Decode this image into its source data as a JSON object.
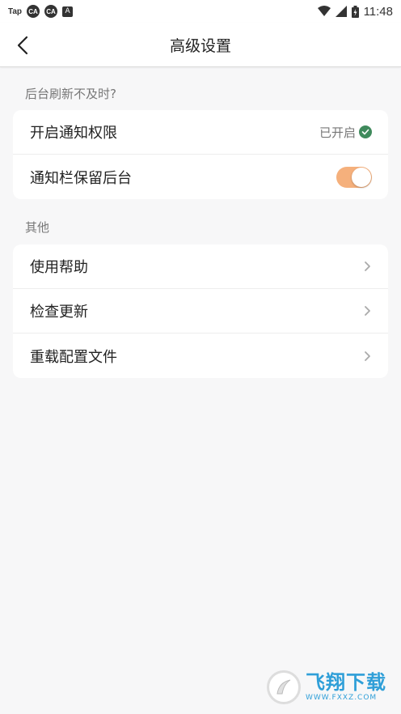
{
  "statusbar": {
    "app_label": "Tap",
    "icon1": "CA",
    "icon2": "CA",
    "icon3": "A",
    "time": "11:48"
  },
  "header": {
    "title": "高级设置"
  },
  "sections": [
    {
      "label": "后台刷新不及时?",
      "rows": [
        {
          "label": "开启通知权限",
          "status": "已开启"
        },
        {
          "label": "通知栏保留后台",
          "toggle": true
        }
      ]
    },
    {
      "label": "其他",
      "rows": [
        {
          "label": "使用帮助"
        },
        {
          "label": "检查更新"
        },
        {
          "label": "重载配置文件"
        }
      ]
    }
  ],
  "watermark": {
    "cn": "飞翔下载",
    "url": "WWW.FXXZ.COM"
  },
  "colors": {
    "toggle_on": "#f5b07c",
    "check_green": "#3f8a5c",
    "watermark_blue": "#2f9fd8"
  }
}
